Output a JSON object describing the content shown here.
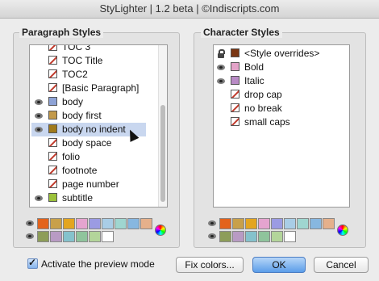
{
  "window": {
    "title": "StyLighter | 1.2 beta | ©Indiscripts.com"
  },
  "paragraph_styles": {
    "title": "Paragraph Styles",
    "items": [
      {
        "label": "TOC 3",
        "swatch": "none",
        "eye": false
      },
      {
        "label": "TOC Title",
        "swatch": "none",
        "eye": false
      },
      {
        "label": "TOC2",
        "swatch": "none",
        "eye": false
      },
      {
        "label": "[Basic Paragraph]",
        "swatch": "none",
        "eye": false
      },
      {
        "label": "body",
        "swatch": "#8ea3d6",
        "eye": true
      },
      {
        "label": "body first",
        "swatch": "#c39a4b",
        "eye": true
      },
      {
        "label": "body no indent",
        "swatch": "#a07a1b",
        "eye": true,
        "selected": true
      },
      {
        "label": "body space",
        "swatch": "none",
        "eye": false
      },
      {
        "label": "folio",
        "swatch": "none",
        "eye": false
      },
      {
        "label": "footnote",
        "swatch": "none",
        "eye": false
      },
      {
        "label": "page number",
        "swatch": "none",
        "eye": false
      },
      {
        "label": "subtitle",
        "swatch": "#9cc23b",
        "eye": true
      }
    ],
    "palette_row1": [
      "#e3631c",
      "#c8a04a",
      "#e3a51f",
      "#e5a4cf",
      "#9b9be3",
      "#a9cde6",
      "#9fd6d0",
      "#87b7e0",
      "#e5b08b"
    ],
    "palette_row2": [
      "#8d9d59",
      "#b89bc4",
      "#85c2cc",
      "#8fc49c",
      "#b3d59a",
      "#ffffff"
    ]
  },
  "character_styles": {
    "title": "Character Styles",
    "items": [
      {
        "label": "<Style overrides>",
        "swatch": "#7a3512",
        "icon": "lock"
      },
      {
        "label": "Bold",
        "swatch": "#e3a3c8",
        "icon": "eye"
      },
      {
        "label": "Italic",
        "swatch": "#b98bc6",
        "icon": "eye"
      },
      {
        "label": "drop cap",
        "swatch": "none",
        "icon": ""
      },
      {
        "label": "no break",
        "swatch": "none",
        "icon": ""
      },
      {
        "label": "small caps",
        "swatch": "none",
        "icon": ""
      }
    ],
    "palette_row1": [
      "#e3631c",
      "#c8a04a",
      "#e3a51f",
      "#e5a4cf",
      "#9b9be3",
      "#a9cde6",
      "#9fd6d0",
      "#87b7e0",
      "#e5b08b"
    ],
    "palette_row2": [
      "#8d9d59",
      "#b89bc4",
      "#85c2cc",
      "#8fc49c",
      "#b3d59a",
      "#ffffff"
    ]
  },
  "footer": {
    "checkbox_label": "Activate the preview mode",
    "checkbox_checked": true,
    "fix_colors_label": "Fix colors...",
    "ok_label": "OK",
    "cancel_label": "Cancel"
  }
}
